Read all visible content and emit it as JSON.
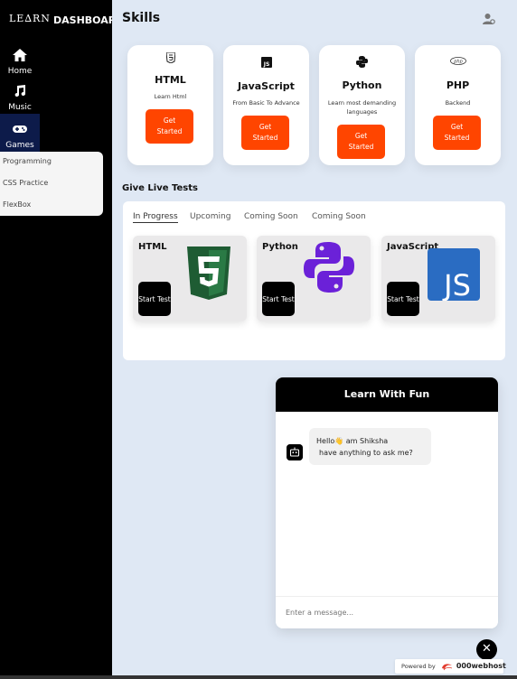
{
  "sidebar": {
    "logo": "LE∆RN",
    "title": "DASHBOARD",
    "nav": [
      {
        "label": "Home",
        "icon": "home-icon"
      },
      {
        "label": "Music",
        "icon": "music-icon"
      },
      {
        "label": "Games",
        "icon": "gamepad-icon"
      }
    ],
    "dropdown": [
      "Programming",
      "CSS Practice",
      "FlexBox"
    ]
  },
  "header": {
    "title": "Skills",
    "user_icon": "user-settings-icon"
  },
  "skills": [
    {
      "title": "HTML",
      "subtitle": "Learn Html",
      "button": "Get Started",
      "icon": "html5-icon"
    },
    {
      "title": "JavaScript",
      "subtitle": "From Basic To Advance",
      "button": "Get Started",
      "icon": "js-icon"
    },
    {
      "title": "Python",
      "subtitle": "Learn most demanding languages",
      "button": "Get Started",
      "icon": "python-icon"
    },
    {
      "title": "PHP",
      "subtitle": "Backend",
      "button": "Get Started",
      "icon": "php-icon"
    }
  ],
  "tests": {
    "section_title": "Give Live Tests",
    "tabs": [
      "In Progress",
      "Upcoming",
      "Coming Soon",
      "Coming Soon"
    ],
    "cards": [
      {
        "title": "HTML",
        "button": "Start Test"
      },
      {
        "title": "Python",
        "button": "Start Test"
      },
      {
        "title": "JavaScript",
        "button": "Start Test"
      }
    ]
  },
  "chat": {
    "header": "Learn With Fun",
    "message_line1": "Hello👋 am Shiksha",
    "message_line2": "have anything to ask me?",
    "placeholder": "Enter a message..."
  },
  "footer": {
    "close": "✕",
    "powered_by": "Powered by",
    "host": "000webhost"
  },
  "colors": {
    "accent": "#ff4500",
    "sidebar": "#000000",
    "background": "#dfe8f4"
  }
}
